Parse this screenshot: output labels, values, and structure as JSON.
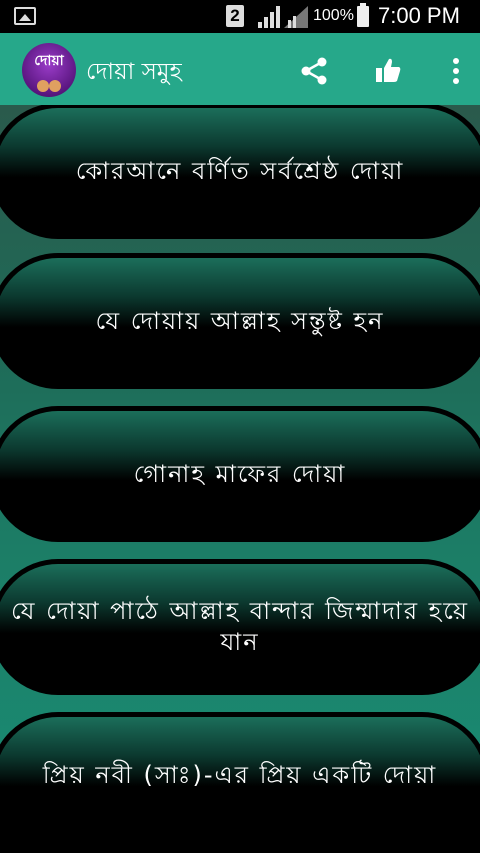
{
  "status_bar": {
    "sim_slot": "2",
    "battery_percent": "100%",
    "time": "7:00 PM"
  },
  "app_bar": {
    "logo_text": "দোয়া",
    "title": "দোয়া সমুহ",
    "actions": [
      "share-icon",
      "thumbs-up-icon",
      "overflow-menu-icon"
    ]
  },
  "items": [
    {
      "label": "কোরআনে বর্ণিত সর্বশ্রেষ্ঠ দোয়া"
    },
    {
      "label": "যে দোয়ায় আল্লাহ সন্তুষ্ট হন"
    },
    {
      "label": "গোনাহ মাফের দোয়া"
    },
    {
      "label": "যে দোয়া পাঠে আল্লাহ বান্দার জিম্মাদার হয়ে যান"
    },
    {
      "label": "প্রিয় নবী (সাঃ)-এর প্রিয় একটি দোয়া"
    }
  ]
}
